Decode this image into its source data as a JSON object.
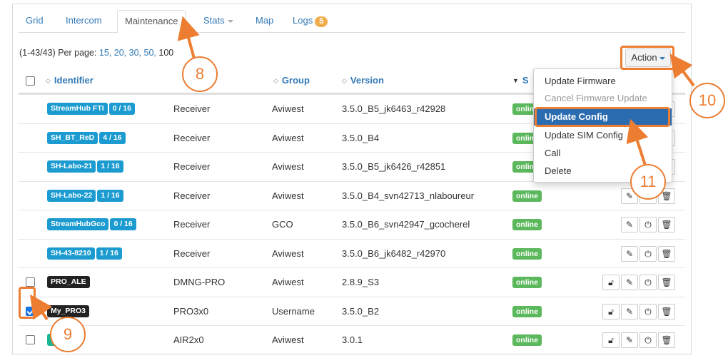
{
  "tabs": [
    "Grid",
    "Intercom",
    "Maintenance",
    "Stats",
    "Map",
    "Logs"
  ],
  "logs_count": "5",
  "perpage": {
    "prefix": "(1-43/43) Per page:",
    "options": [
      "15,",
      "20,",
      "30,",
      "50,"
    ],
    "current": "100"
  },
  "action_label": "Action",
  "columns": {
    "identifier": "Identifier",
    "type_partial": "t",
    "group": "Group",
    "version": "Version",
    "status_partial": "S"
  },
  "rows": [
    {
      "id": "StreamHub FTI",
      "count": "0 / 16",
      "type": "Receiver",
      "group": "Aviwest",
      "version": "3.5.0_B5_jk6463_r42928",
      "status": "online",
      "style": "blue",
      "checkbox": false,
      "checked": false,
      "lock": false
    },
    {
      "id": "SH_BT_ReD",
      "count": "4 / 16",
      "type": "Receiver",
      "group": "Aviwest",
      "version": "3.5.0_B4",
      "status": "online",
      "style": "blue",
      "checkbox": false,
      "checked": false,
      "lock": false
    },
    {
      "id": "SH-Labo-21",
      "count": "1 / 16",
      "type": "Receiver",
      "group": "Aviwest",
      "version": "3.5.0_B5_jk6426_r42851",
      "status": "online",
      "style": "blue",
      "checkbox": false,
      "checked": false,
      "lock": false
    },
    {
      "id": "SH-Labo-22",
      "count": "1 / 16",
      "type": "Receiver",
      "group": "Aviwest",
      "version": "3.5.0_B4_svn42713_nlaboureur",
      "status": "online",
      "style": "blue",
      "checkbox": false,
      "checked": false,
      "lock": false
    },
    {
      "id": "StreamHubGco",
      "count": "0 / 16",
      "type": "Receiver",
      "group": "GCO",
      "version": "3.5.0_B6_svn42947_gcocherel",
      "status": "online",
      "style": "blue",
      "checkbox": false,
      "checked": false,
      "lock": false
    },
    {
      "id": "SH-43-8210",
      "count": "1 / 16",
      "type": "Receiver",
      "group": "Aviwest",
      "version": "3.5.0_B6_jk6482_r42970",
      "status": "online",
      "style": "blue",
      "checkbox": false,
      "checked": false,
      "lock": false
    },
    {
      "id": "PRO_ALE",
      "count": "",
      "type": "DMNG-PRO",
      "group": "Aviwest",
      "version": "2.8.9_S3",
      "status": "online",
      "style": "dark",
      "checkbox": true,
      "checked": false,
      "lock": true
    },
    {
      "id": "My_PRO3",
      "count": "",
      "type": "PRO3x0",
      "group": "Username",
      "version": "3.5.0_B2",
      "status": "online",
      "style": "dark",
      "checkbox": true,
      "checked": true,
      "lock": true
    },
    {
      "id": "SLA",
      "count": "",
      "type": "AIR2x0",
      "group": "Aviwest",
      "version": "3.0.1",
      "status": "online",
      "style": "teal",
      "checkbox": true,
      "checked": false,
      "lock": true
    }
  ],
  "menu": [
    "Update Firmware",
    "Cancel Firmware Update",
    "Update Config",
    "Update SIM Config",
    "Call",
    "Delete"
  ],
  "annotations": [
    "8",
    "9",
    "10",
    "11"
  ],
  "icons": {
    "sort": "sort-icon",
    "lock": "unlock-icon",
    "edit": "edit-icon",
    "power": "power-icon",
    "delete": "trash-icon"
  },
  "colors": {
    "accent": "#ec7d31",
    "link": "#337ab7",
    "online": "#5cb85c",
    "menu_active": "#2b6cb0"
  }
}
